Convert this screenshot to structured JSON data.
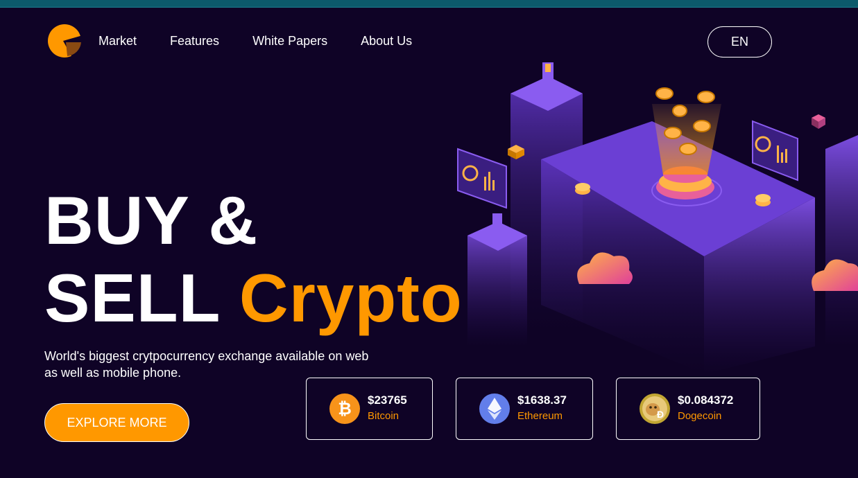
{
  "nav": {
    "items": [
      {
        "label": "Market"
      },
      {
        "label": "Features"
      },
      {
        "label": "White Papers"
      },
      {
        "label": "About Us"
      }
    ],
    "language_label": "EN"
  },
  "hero": {
    "title_line1": "BUY &",
    "title_line2_plain": "SELL",
    "title_line2_accent": "Crypto",
    "subtitle": "World's biggest crytpocurrency exchange available on web as well as mobile phone.",
    "cta_label": "EXPLORE MORE"
  },
  "coins": [
    {
      "price": "$23765",
      "name": "Bitcoin",
      "icon": "bitcoin-icon"
    },
    {
      "price": "$1638.37",
      "name": "Ethereum",
      "icon": "ethereum-icon"
    },
    {
      "price": "$0.084372",
      "name": "Dogecoin",
      "icon": "dogecoin-icon"
    }
  ],
  "colors": {
    "background": "#0f0326",
    "accent": "#ff9800",
    "illustration_purple": "#6b3fd4",
    "bitcoin": "#f7931a",
    "ethereum": "#627eea"
  }
}
